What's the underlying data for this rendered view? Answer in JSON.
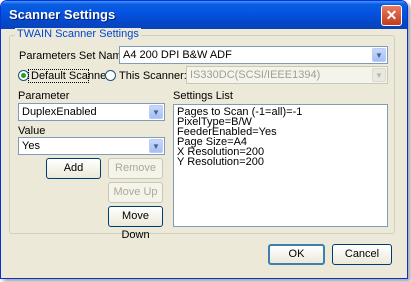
{
  "window": {
    "title": "Scanner Settings",
    "close_glyph": "✕"
  },
  "group": {
    "title": "TWAIN Scanner Settings"
  },
  "params_set": {
    "label": "Parameters Set Name",
    "value": "A4 200 DPI B&W ADF"
  },
  "scanner": {
    "default_label": "Default Scanner",
    "this_label": "This Scanner:",
    "selected": "default",
    "this_value": "IS330DC(SCSI/IEEE1394)"
  },
  "parameter": {
    "label": "Parameter",
    "value": "DuplexEnabled"
  },
  "value": {
    "label": "Value",
    "value": "Yes"
  },
  "buttons": {
    "add": "Add",
    "remove": "Remove",
    "move_up": "Move Up",
    "move_down": "Move Down",
    "ok": "OK",
    "cancel": "Cancel"
  },
  "settings_list": {
    "label": "Settings List",
    "items": [
      "Pages to Scan (-1=all)=-1",
      "PixelType=B/W",
      "FeederEnabled=Yes",
      "Page Size=A4",
      "X Resolution=200",
      "Y Resolution=200"
    ]
  },
  "icons": {
    "dropdown": "chevron-down-icon",
    "close": "close-icon"
  }
}
